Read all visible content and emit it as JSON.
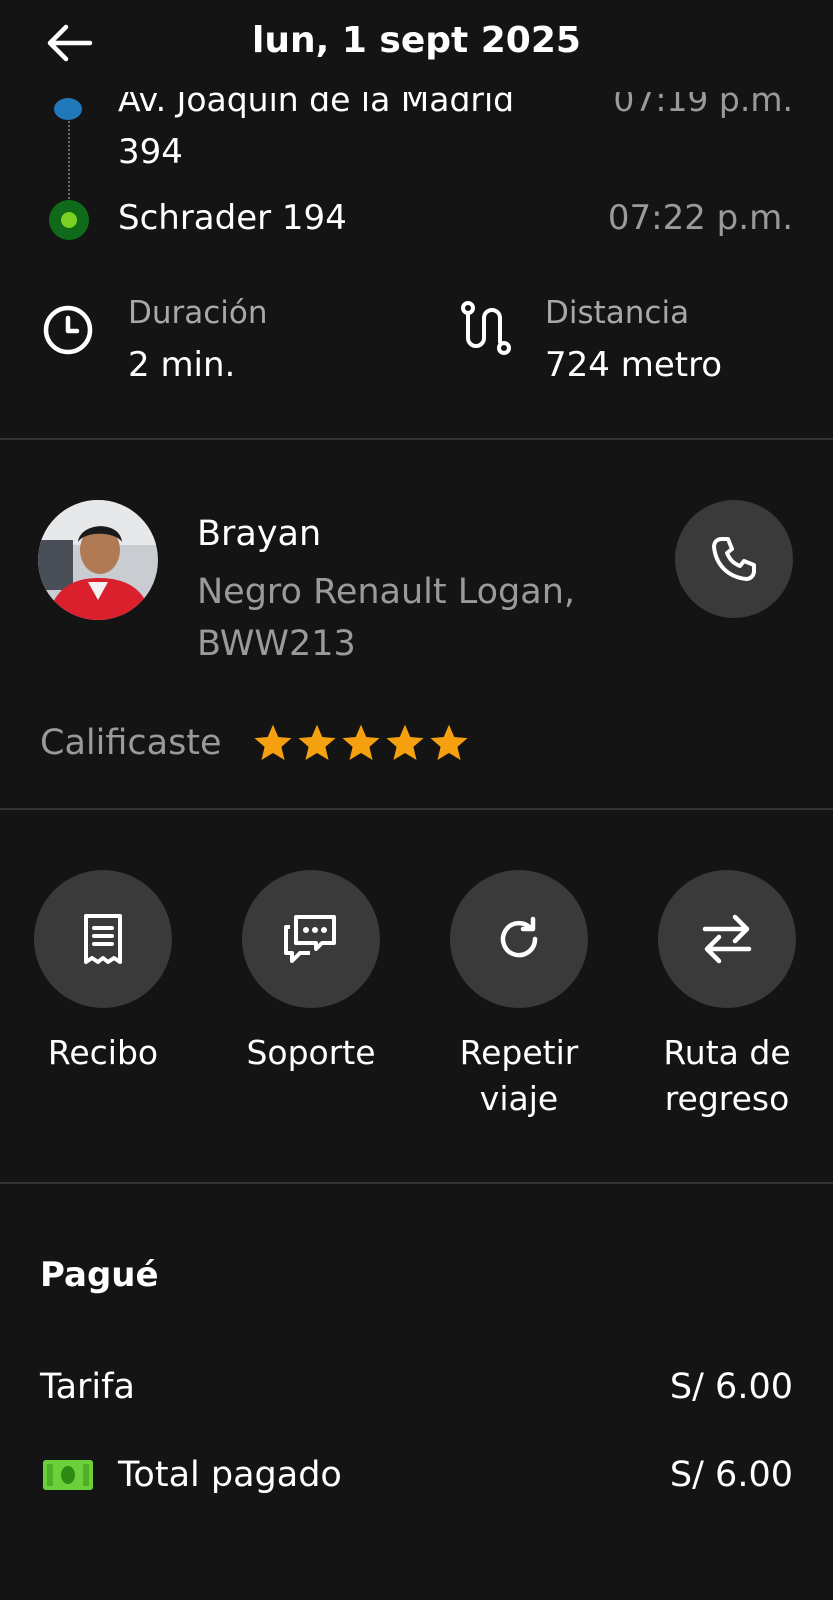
{
  "header": {
    "title": "lun, 1 sept 2025",
    "back_icon": "arrow-left-icon"
  },
  "route": {
    "origin": {
      "address_partial": "Av. Joaquín de la Madrid",
      "address_line2": "394",
      "time_partial": "07:19 p.m."
    },
    "destination": {
      "address": "Schrader 194",
      "time": "07:22 p.m."
    }
  },
  "stats": {
    "duration": {
      "label": "Duración",
      "value": "2 min.",
      "icon": "clock-icon"
    },
    "distance": {
      "label": "Distancia",
      "value": "724 metro",
      "icon": "route-icon"
    }
  },
  "driver": {
    "name": "Brayan",
    "vehicle": "Negro Renault Logan, BWW213",
    "call_icon": "phone-icon",
    "rated_label": "Calificaste",
    "rating": 5,
    "rating_max": 5,
    "star_color": "#f5a00f"
  },
  "actions": [
    {
      "label": "Recibo",
      "icon": "receipt-icon"
    },
    {
      "label": "Soporte",
      "icon": "chat-icon"
    },
    {
      "label": "Repetir viaje",
      "icon": "repeat-icon"
    },
    {
      "label": "Ruta de regreso",
      "icon": "swap-arrows-icon"
    }
  ],
  "payment": {
    "title": "Pagué",
    "fare_label": "Tarifa",
    "fare_value": "S/ 6.00",
    "total_label": "Total pagado",
    "total_value": "S/ 6.00",
    "cash_icon": "cash-icon",
    "cash_color": "#6bd03a"
  }
}
